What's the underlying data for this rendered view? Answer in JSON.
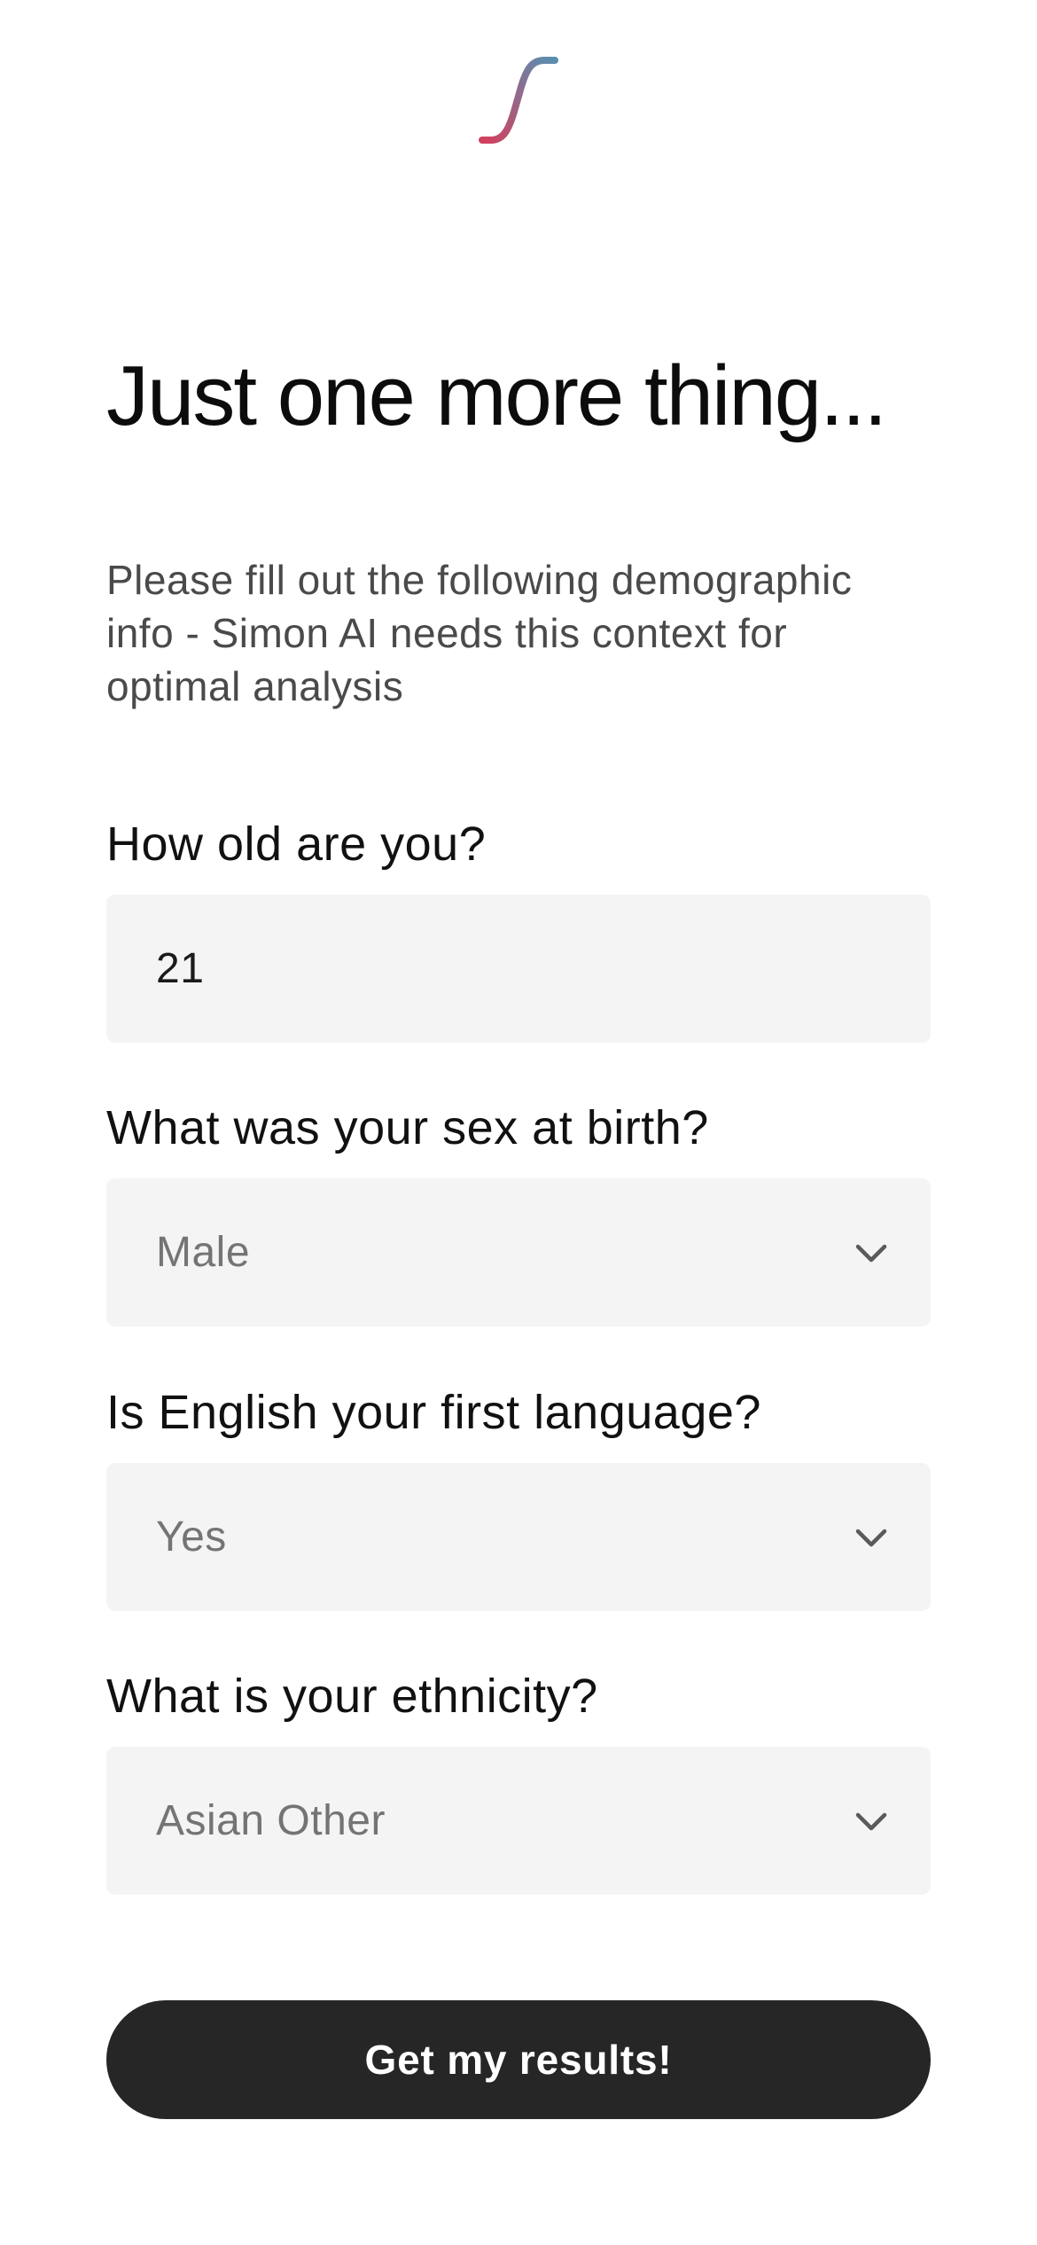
{
  "header": {
    "logo_icon": "integral-s-curve-logo",
    "logo_colors": {
      "top": "#5A8EB0",
      "bottom": "#D2405E"
    }
  },
  "main": {
    "title": "Just one more thing...",
    "subtitle": "Please fill out the following demographic info - Simon AI needs this context for optimal analysis"
  },
  "form": {
    "age": {
      "label": "How old are you?",
      "value": "21"
    },
    "sex": {
      "label": "What was your sex at birth?",
      "value": "Male",
      "icon": "chevron-down-icon"
    },
    "english": {
      "label": "Is English your first language?",
      "value": "Yes",
      "icon": "chevron-down-icon"
    },
    "ethnicity": {
      "label": "What is your ethnicity?",
      "value": "Asian Other",
      "icon": "chevron-down-icon"
    },
    "submit_label": "Get my results!"
  },
  "colors": {
    "field_bg": "#F4F4F4",
    "button_bg": "#262626",
    "button_text": "#FFFFFF",
    "select_text": "#747474"
  }
}
